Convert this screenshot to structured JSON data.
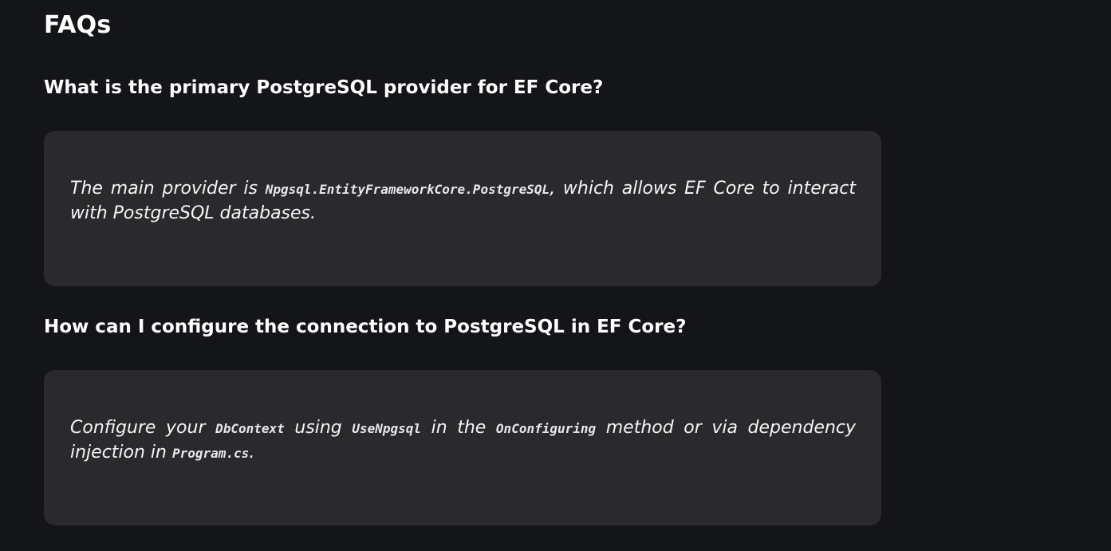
{
  "faq": {
    "title": "FAQs",
    "items": [
      {
        "question": "What is the primary PostgreSQL provider for EF Core?",
        "answer": {
          "t1": "The main provider is ",
          "c1": "Npgsql.EntityFrameworkCore.PostgreSQL",
          "t2": ", which allows EF Core to interact with PostgreSQL databases."
        }
      },
      {
        "question": "How can I configure the connection to PostgreSQL in EF Core?",
        "answer": {
          "t1": "Configure your ",
          "c1": "DbContext",
          "t2": " using ",
          "c2": "UseNpgsql",
          "t3": " in the ",
          "c3": "OnConfiguring",
          "t4": " method or via dependency injection in ",
          "c4": "Program.cs",
          "t5": "."
        }
      }
    ]
  },
  "colors": {
    "background": "#141518",
    "card": "#2a2a2d",
    "text": "#ffffff"
  }
}
